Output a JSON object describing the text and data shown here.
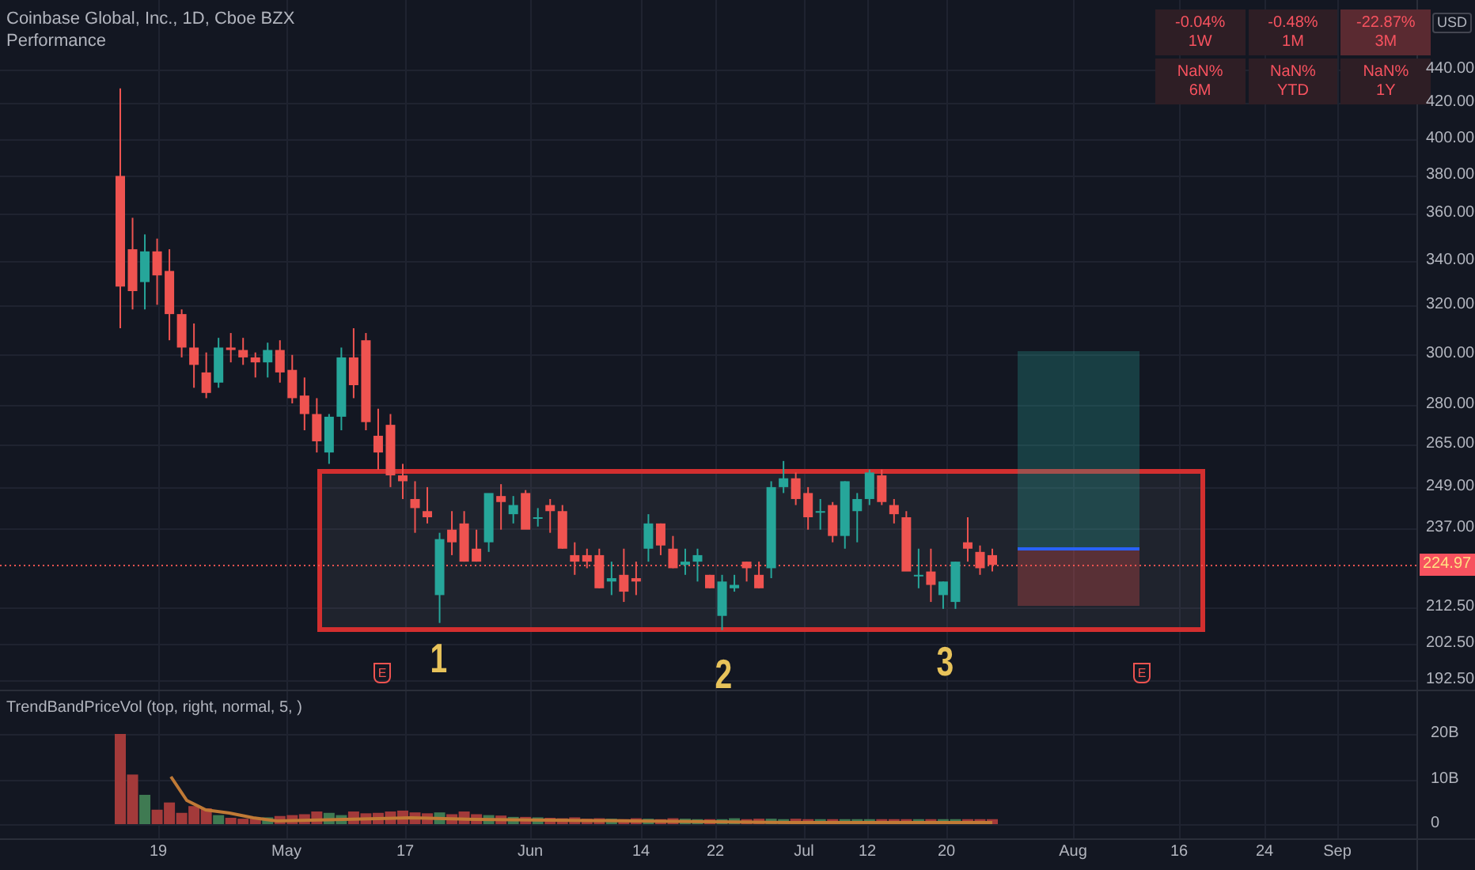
{
  "legend": {
    "title": "Coinbase Global, Inc., 1D, Cboe BZX",
    "indicator": "Performance"
  },
  "performance": [
    {
      "value": "-0.04%",
      "period": "1W",
      "strong": false
    },
    {
      "value": "-0.48%",
      "period": "1M",
      "strong": false
    },
    {
      "value": "-22.87%",
      "period": "3M",
      "strong": true
    },
    {
      "value": "NaN%",
      "period": "6M",
      "strong": false
    },
    {
      "value": "NaN%",
      "period": "YTD",
      "strong": false
    },
    {
      "value": "NaN%",
      "period": "1Y",
      "strong": false
    }
  ],
  "price_axis": {
    "currency": "USD",
    "labels": [
      "440.00",
      "420.00",
      "400.00",
      "380.00",
      "360.00",
      "340.00",
      "320.00",
      "300.00",
      "280.00",
      "265.00",
      "249.00",
      "237.00",
      "212.50",
      "202.50",
      "192.50"
    ],
    "current_price": "224.97"
  },
  "annotations": [
    "1",
    "2",
    "3"
  ],
  "earnings_markers": [
    "E",
    "E"
  ],
  "volume_pane": {
    "title": "TrendBandPriceVol (top, right, normal, 5, )",
    "labels": [
      "20B",
      "10B",
      "0"
    ]
  },
  "time_axis": [
    "19",
    "May",
    "17",
    "Jun",
    "14",
    "22",
    "Jul",
    "12",
    "20",
    "Aug",
    "16",
    "24",
    "Sep"
  ]
}
